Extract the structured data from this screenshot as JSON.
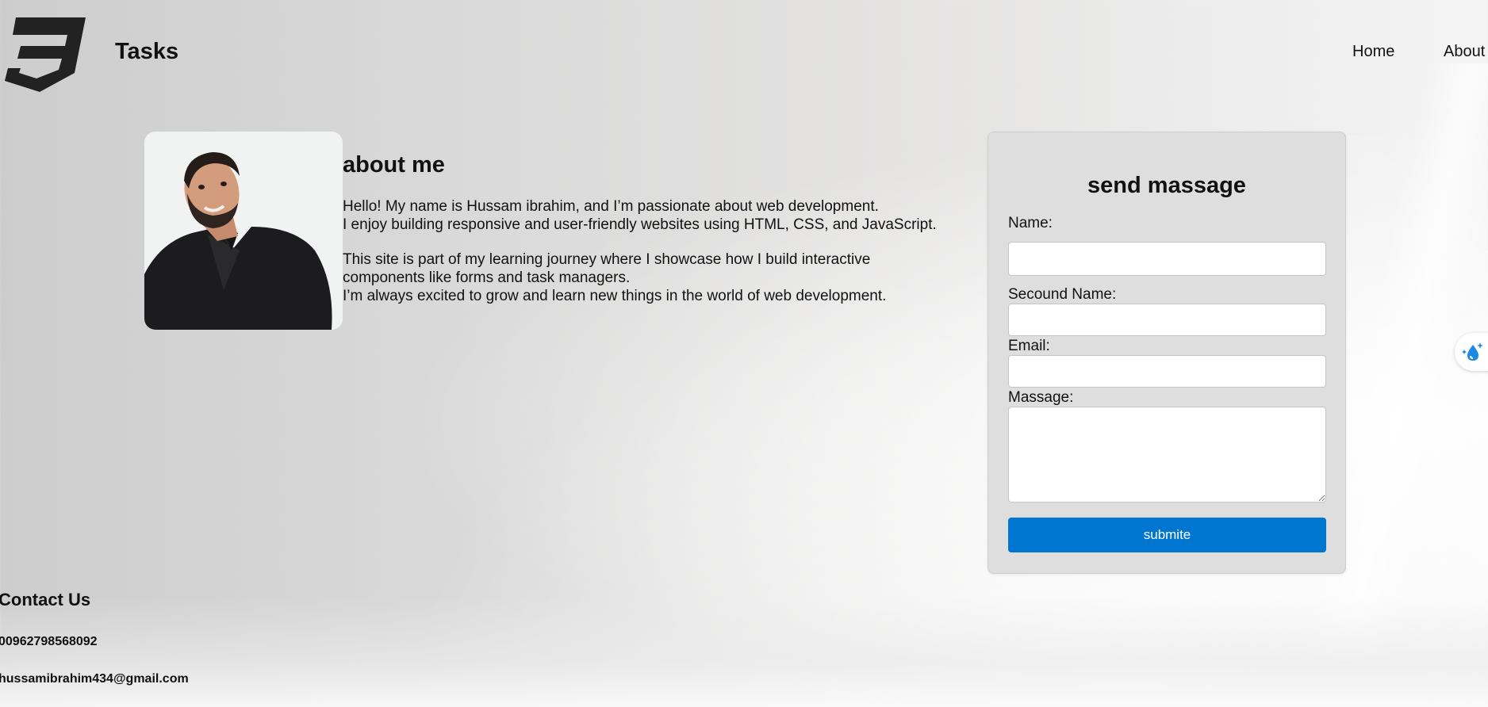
{
  "header": {
    "brand": "Tasks",
    "nav": [
      {
        "label": "Home"
      },
      {
        "label": "About"
      }
    ]
  },
  "about": {
    "title": "about me",
    "paragraphs": [
      "Hello! My name is Hussam ibrahim, and I’m passionate about web development.\nI enjoy building responsive and user-friendly websites using HTML, CSS, and JavaScript.",
      "This site is part of my learning journey where I showcase how I build interactive components like forms and task managers.\nI’m always excited to grow and learn new things in the world of web development."
    ]
  },
  "form": {
    "title": "send massage",
    "labels": {
      "name": "Name:",
      "second_name": "Secound Name:",
      "email": "Email:",
      "message": "Massage:"
    },
    "values": {
      "name": "",
      "second_name": "",
      "email": "",
      "message": ""
    },
    "submit_label": "submite"
  },
  "contact": {
    "title": "Contact Us",
    "phone": "00962798568092",
    "email": "hussamibrahim434@gmail.com"
  },
  "colors": {
    "accent": "#0076d1",
    "card_bg": "#dfdedf"
  },
  "icons": {
    "logo": "css3-shield-icon",
    "widget": "water-drop-sparkle-icon"
  }
}
